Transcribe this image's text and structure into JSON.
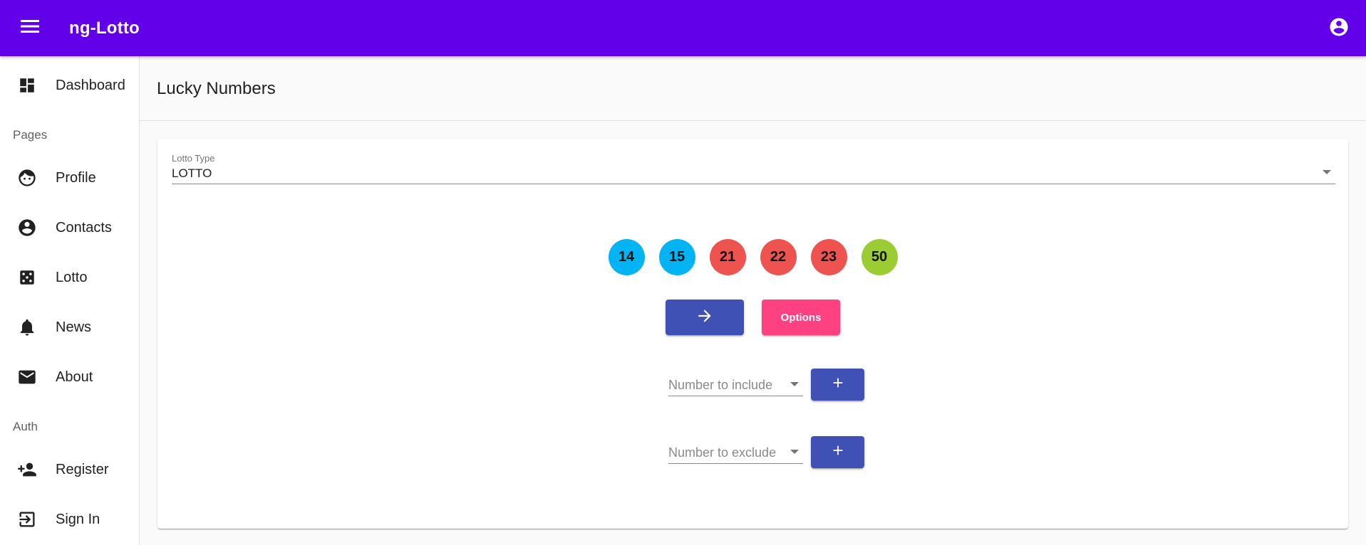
{
  "toolbar": {
    "title": "ng-Lotto",
    "menu_icon": "menu-icon",
    "account_icon": "account-circle-icon"
  },
  "sidebar": {
    "top_items": [
      {
        "label": "Dashboard",
        "icon": "dashboard-icon"
      }
    ],
    "sections": [
      {
        "label": "Pages",
        "items": [
          {
            "label": "Profile",
            "icon": "face-icon"
          },
          {
            "label": "Contacts",
            "icon": "account-circle-icon"
          },
          {
            "label": "Lotto",
            "icon": "dice-icon"
          },
          {
            "label": "News",
            "icon": "bell-icon"
          },
          {
            "label": "About",
            "icon": "mail-icon"
          }
        ]
      },
      {
        "label": "Auth",
        "items": [
          {
            "label": "Register",
            "icon": "person-add-icon"
          },
          {
            "label": "Sign In",
            "icon": "login-icon"
          }
        ]
      }
    ]
  },
  "main": {
    "page_title": "Lucky Numbers",
    "lotto_type": {
      "label": "Lotto Type",
      "value": "LOTTO"
    },
    "numbers": [
      {
        "value": "14",
        "color": "#03b4f4"
      },
      {
        "value": "15",
        "color": "#03b4f4"
      },
      {
        "value": "21",
        "color": "#ef5350"
      },
      {
        "value": "22",
        "color": "#ef5350"
      },
      {
        "value": "23",
        "color": "#ef5350"
      },
      {
        "value": "50",
        "color": "#9ccc34"
      }
    ],
    "generate_icon": "arrow-right-icon",
    "options_label": "Options",
    "include": {
      "placeholder": "Number to include",
      "add_icon": "plus-icon"
    },
    "exclude": {
      "placeholder": "Number to exclude",
      "add_icon": "plus-icon"
    }
  },
  "colors": {
    "toolbar": "#6200ea",
    "primary": "#3f51b5",
    "accent": "#ff4081"
  }
}
